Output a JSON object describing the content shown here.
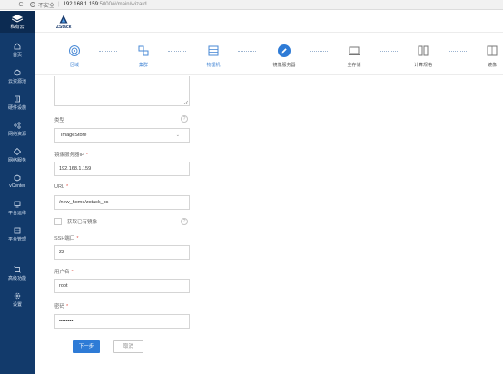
{
  "browser": {
    "back": "←",
    "forward": "→",
    "reload": "C",
    "security_label": "不安全",
    "url_host": "192.168.1.159",
    "url_rest": ":5000/#/main/wizard"
  },
  "brand": {
    "label": "私有云"
  },
  "sidebar": {
    "items": [
      {
        "label": "首页",
        "icon": "home-icon"
      },
      {
        "label": "云资源池",
        "icon": "cloud-icon"
      },
      {
        "label": "硬件设施",
        "icon": "building-icon"
      },
      {
        "label": "网络资源",
        "icon": "network-icon"
      },
      {
        "label": "网络服务",
        "icon": "network-service-icon"
      },
      {
        "label": "vCenter",
        "icon": "vcenter-icon"
      },
      {
        "label": "平台运维",
        "icon": "monitor-icon"
      },
      {
        "label": "平台管理",
        "icon": "manage-icon"
      },
      {
        "label": "高级功能",
        "icon": "advanced-icon"
      },
      {
        "label": "设置",
        "icon": "gear-icon"
      }
    ]
  },
  "header": {
    "logo_text": "ZStack"
  },
  "wizard": {
    "steps": [
      {
        "label": "区域",
        "state": "done"
      },
      {
        "label": "集群",
        "state": "done"
      },
      {
        "label": "物理机",
        "state": "done"
      },
      {
        "label": "镜像服务器",
        "state": "active"
      },
      {
        "label": "主存储",
        "state": "todo"
      },
      {
        "label": "计算规格",
        "state": "todo"
      },
      {
        "label": "镜像",
        "state": "todo"
      }
    ]
  },
  "form": {
    "type_label": "类型",
    "type_value": "ImageStore",
    "ip_label": "镜像服务器IP",
    "ip_value": "192.168.1.159",
    "url_label": "URL",
    "url_value": "/new_home/zstack_bs",
    "fetch_label": "获取已有镜像",
    "ssh_label": "SSH端口",
    "ssh_value": "22",
    "user_label": "用户名",
    "user_value": "root",
    "pass_label": "密码",
    "pass_value": "••••••••",
    "required_mark": "*",
    "help_mark": "?"
  },
  "buttons": {
    "next": "下一步",
    "cancel": "取消"
  },
  "colors": {
    "sidebar": "#123a6b",
    "brand": "#0c2b52",
    "accent": "#2e7bd6"
  }
}
